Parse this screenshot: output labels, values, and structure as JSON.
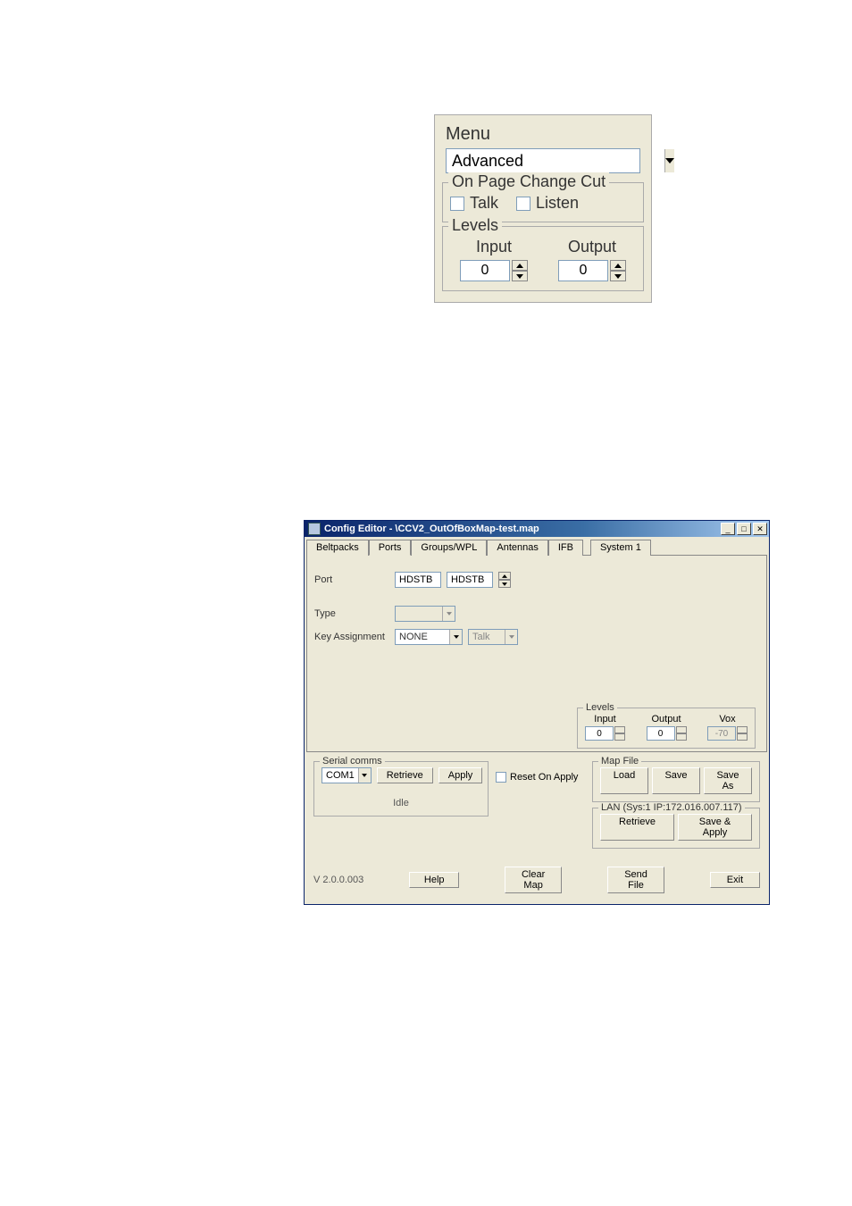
{
  "panel1": {
    "menu_label": "Menu",
    "menu_value": "Advanced",
    "cut_legend": "On Page Change Cut",
    "talk_label": "Talk",
    "listen_label": "Listen",
    "levels_legend": "Levels",
    "input_label": "Input",
    "output_label": "Output",
    "input_val": "0",
    "output_val": "0"
  },
  "win2": {
    "title": "Config Editor - \\CCV2_OutOfBoxMap-test.map",
    "tabs": {
      "beltpacks": "Beltpacks",
      "ports": "Ports",
      "groups": "Groups/WPL",
      "antennas": "Antennas",
      "ifb": "IFB",
      "system1": "System 1"
    },
    "port_label": "Port",
    "port_val": "HDSTB",
    "port_name": "HDSTB",
    "type_label": "Type",
    "type_val": "",
    "key_label": "Key Assignment",
    "key_val": "NONE",
    "key_talk": "Talk",
    "levels_legend": "Levels",
    "lvl_input": "Input",
    "lvl_output": "Output",
    "lvl_vox": "Vox",
    "lvl_input_val": "0",
    "lvl_output_val": "0",
    "lvl_vox_val": "-70",
    "serial_legend": "Serial comms",
    "serial_port": "COM1",
    "retrieve": "Retrieve",
    "apply": "Apply",
    "idle": "Idle",
    "reset_label": "Reset On Apply",
    "mapfile_legend": "Map File",
    "load": "Load",
    "save": "Save",
    "saveas": "Save As",
    "lan_legend": "LAN (Sys:1 IP:172.016.007.117)",
    "lan_retrieve": "Retrieve",
    "lan_saveapply": "Save & Apply",
    "version": "V 2.0.0.003",
    "help": "Help",
    "clearmap": "Clear Map",
    "sendfile": "Send File",
    "exit": "Exit"
  }
}
